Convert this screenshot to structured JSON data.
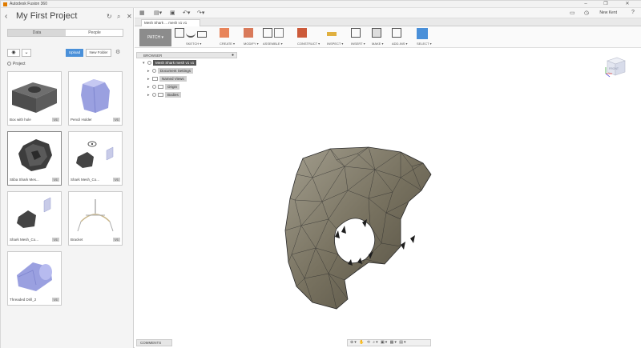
{
  "window": {
    "title": "Autodesk Fusion 360",
    "minimize": "–",
    "maximize": "❐",
    "close": "✕"
  },
  "data_panel": {
    "project_title": "My First Project",
    "back_glyph": "‹",
    "refresh_glyph": "↻",
    "search_glyph": "⌕",
    "close_glyph": "✕",
    "tabs": [
      {
        "label": "Data",
        "active": true
      },
      {
        "label": "People",
        "active": false
      }
    ],
    "hub_glyph": "◉",
    "hub_dropdown_glyph": "⌄",
    "upload_label": "Upload",
    "new_folder_label": "New Folder",
    "settings_glyph": "⚙",
    "breadcrumb": "Project",
    "files": [
      {
        "name": "Box with hole",
        "version": "V1",
        "icon": "solid-box-thumbnail"
      },
      {
        "name": "Pencil Holder",
        "version": "V1",
        "icon": "pencil-holder-thumbnail"
      },
      {
        "name": "Stiba Shark Mes...",
        "version": "V1",
        "icon": "shark-mesh-thumbnail"
      },
      {
        "name": "Shark Mesh_Co...",
        "version": "V1",
        "icon": "shark-mesh-assembly-thumbnail"
      },
      {
        "name": "Shark Mesh_Co...",
        "version": "V1",
        "icon": "shark-mesh-copy-thumbnail"
      },
      {
        "name": "Bracket",
        "version": "V1",
        "icon": "bracket-thumbnail"
      },
      {
        "name": "Threaded Drill_2",
        "version": "V1",
        "icon": "threaded-part-thumbnail"
      }
    ]
  },
  "quick_access": {
    "user_name": "New Kent"
  },
  "document_tab": {
    "label": "Mesh Shark ... mesh v1 v1",
    "close_glyph": "✕"
  },
  "toolbar": {
    "workspace_label": "PATCH ▾",
    "groups": [
      "SKETCH ▾",
      "CREATE ▾",
      "MODIFY ▾",
      "ASSEMBLE ▾",
      "CONSTRUCT ▾",
      "INSPECT ▾",
      "INSERT ▾",
      "MAKE ▾",
      "ADD-INS ▾",
      "SELECT ▾"
    ]
  },
  "browser": {
    "header": "BROWSER",
    "pin_glyph": "●",
    "items": [
      {
        "label": "Mesh Shark mesh v1 v1",
        "root": true
      },
      {
        "label": "Document Settings",
        "root": false
      },
      {
        "label": "Named Views",
        "root": false
      },
      {
        "label": "Origin",
        "root": false
      },
      {
        "label": "Bodies",
        "root": false
      }
    ]
  },
  "viewcube": {
    "face_label": "FRONT"
  },
  "comments": {
    "label": "COMMENTS"
  },
  "nav_bar": {
    "glyphs": "⊕▾ ✋ ⟲ ⌕▾ ▣▾ ▦▾ ▤▾"
  },
  "colors": {
    "accent_blue": "#4a90d9",
    "panel_bg": "#f4f4f4",
    "workspace_btn": "#8c8c8c",
    "mesh_fill": "#7a7462",
    "mesh_edge": "#2a2a2a"
  }
}
